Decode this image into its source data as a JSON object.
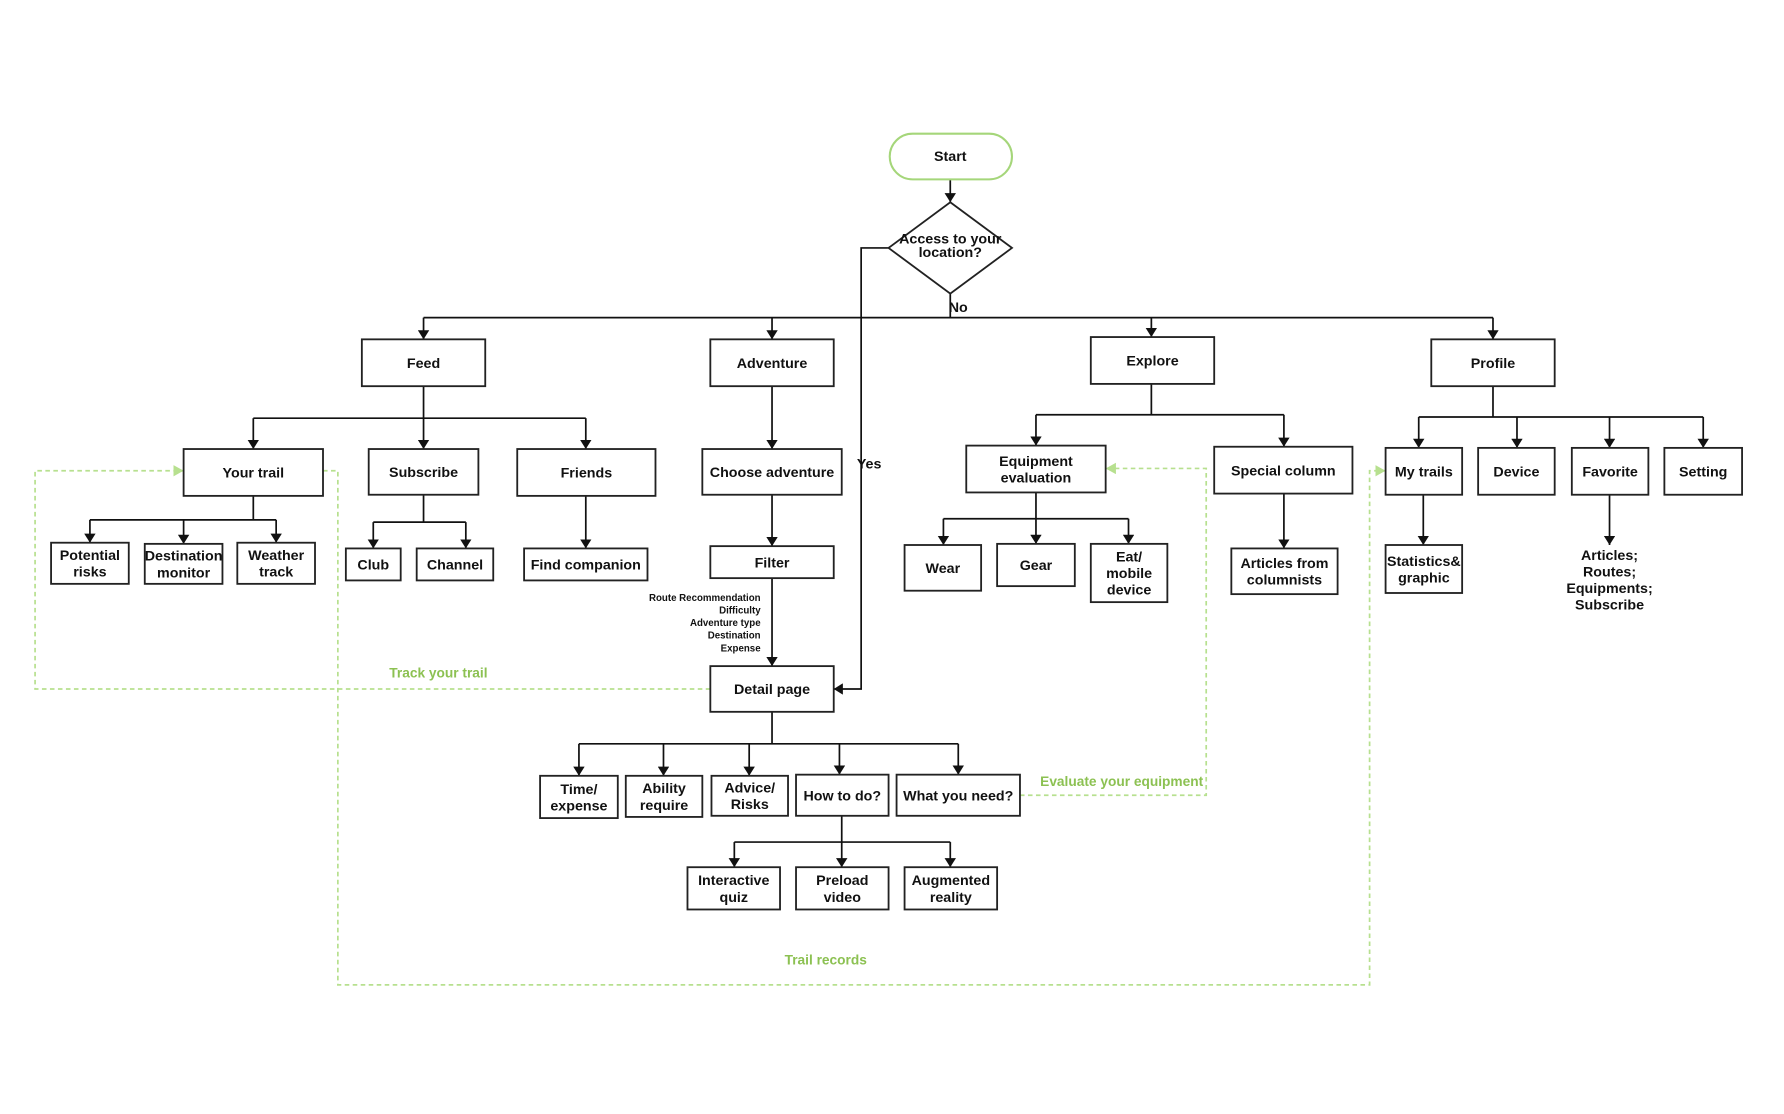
{
  "colors": {
    "accent_green": "#8cc152",
    "dashed_green": "#b7e08f",
    "start_border": "#a5d67a",
    "line": "#111111"
  },
  "start": "Start",
  "decision": {
    "lines": [
      "Access to your",
      "location?"
    ],
    "no_label": "No",
    "yes_label": "Yes"
  },
  "nodes": {
    "feed": [
      "Feed"
    ],
    "adventure": [
      "Adventure"
    ],
    "explore": [
      "Explore"
    ],
    "profile": [
      "Profile"
    ],
    "your_trail": [
      "Your trail"
    ],
    "subscribe": [
      "Subscribe"
    ],
    "friends": [
      "Friends"
    ],
    "choose_adventure": [
      "Choose adventure"
    ],
    "potential_risks": [
      "Potential",
      "risks"
    ],
    "destination_monitor": [
      "Destination",
      "monitor"
    ],
    "weather_track": [
      "Weather",
      "track"
    ],
    "club": [
      "Club"
    ],
    "channel": [
      "Channel"
    ],
    "find_companion": [
      "Find companion"
    ],
    "filter": [
      "Filter"
    ],
    "detail_page": [
      "Detail page"
    ],
    "time_expense": [
      "Time/",
      "expense"
    ],
    "ability_require": [
      "Ability",
      "require"
    ],
    "advice_risks": [
      "Advice/",
      "Risks"
    ],
    "how_to_do": [
      "How to do?"
    ],
    "what_you_need": [
      "What you need?"
    ],
    "interactive_quiz": [
      "Interactive",
      "quiz"
    ],
    "preload_video": [
      "Preload",
      "video"
    ],
    "augmented_reality": [
      "Augmented",
      "reality"
    ],
    "equipment_evaluation": [
      "Equipment",
      "evaluation"
    ],
    "special_column": [
      "Special column"
    ],
    "wear": [
      "Wear"
    ],
    "gear": [
      "Gear"
    ],
    "eat_mobile_device": [
      "Eat/",
      "mobile",
      "device"
    ],
    "articles_from_columnists": [
      "Articles from",
      "columnists"
    ],
    "my_trails": [
      "My trails"
    ],
    "device": [
      "Device"
    ],
    "favorite": [
      "Favorite"
    ],
    "setting": [
      "Setting"
    ],
    "statistics_graphic": [
      "Statistics&",
      "graphic"
    ]
  },
  "filter_criteria": [
    "Route Recommendation",
    "Difficulty",
    "Adventure type",
    "Destination",
    "Expense"
  ],
  "favorite_contents": [
    "Articles;",
    "Routes;",
    "Equipments;",
    "Subscribe"
  ],
  "flow_labels": {
    "track_your_trail": "Track your trail",
    "trail_records": "Trail records",
    "evaluate_your_equipment": "Evaluate your equipment"
  }
}
